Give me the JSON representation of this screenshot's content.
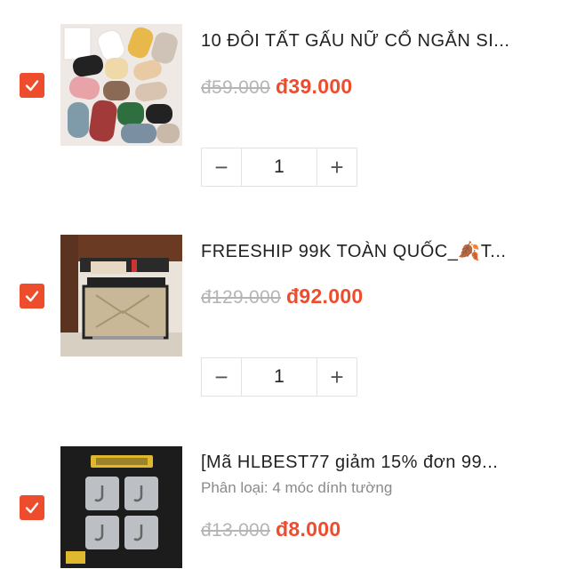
{
  "cart": {
    "items": [
      {
        "title": "10 ĐÔI TẤT GẤU NỮ CỔ NGẮN SI...",
        "old_price": "đ59.000",
        "new_price": "đ39.000",
        "quantity": "1",
        "selected": true,
        "image": "socks-product-image"
      },
      {
        "title": "FREESHIP 99K TOÀN QUỐC_🍂T...",
        "old_price": "đ129.000",
        "new_price": "đ92.000",
        "quantity": "1",
        "selected": true,
        "image": "nightstand-product-image"
      },
      {
        "title": "[Mã HLBEST77 giảm 15% đơn 99...",
        "variant": "Phân loại: 4 móc dính tường",
        "old_price": "đ13.000",
        "new_price": "đ8.000",
        "selected": true,
        "image": "wall-hooks-product-image"
      }
    ],
    "stepper": {
      "minus": "−",
      "plus": "+"
    }
  },
  "colors": {
    "accent": "#ee4d2d",
    "muted": "#b5b5b5"
  },
  "icons": {
    "checkbox": "checkmark-icon"
  }
}
